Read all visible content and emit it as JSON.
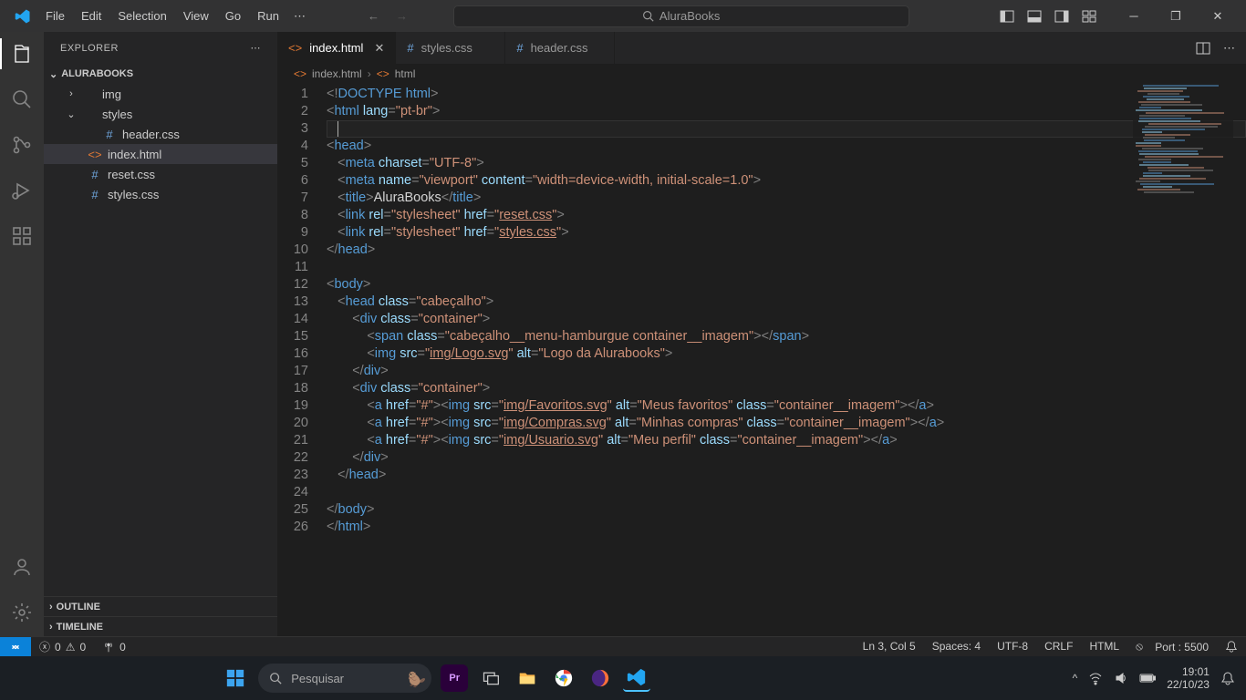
{
  "titlebar": {
    "menu": [
      "File",
      "Edit",
      "Selection",
      "View",
      "Go",
      "Run"
    ],
    "search_text": "AluraBooks"
  },
  "sidebar": {
    "header": "EXPLORER",
    "project": "ALURABOOKS",
    "tree": [
      {
        "label": "img",
        "chev": "›",
        "indent": 18,
        "icon": ""
      },
      {
        "label": "styles",
        "chev": "⌄",
        "indent": 18,
        "icon": ""
      },
      {
        "label": "header.css",
        "chev": "",
        "indent": 40,
        "icon": "#",
        "iclass": "css-ic"
      },
      {
        "label": "index.html",
        "chev": "",
        "indent": 24,
        "icon": "<>",
        "iclass": "html-ic",
        "selected": true
      },
      {
        "label": "reset.css",
        "chev": "",
        "indent": 24,
        "icon": "#",
        "iclass": "css-ic"
      },
      {
        "label": "styles.css",
        "chev": "",
        "indent": 24,
        "icon": "#",
        "iclass": "css-ic"
      }
    ],
    "outline": "OUTLINE",
    "timeline": "TIMELINE"
  },
  "tabs": [
    {
      "label": "index.html",
      "icon": "<>",
      "iclass": "html-ic",
      "active": true
    },
    {
      "label": "styles.css",
      "icon": "#",
      "iclass": "css-ic"
    },
    {
      "label": "header.css",
      "icon": "#",
      "iclass": "css-ic"
    }
  ],
  "breadcrumb": {
    "file": "index.html",
    "node": "html"
  },
  "status": {
    "errors": "0",
    "warnings": "0",
    "ports": "0",
    "lncol": "Ln 3, Col 5",
    "spaces": "Spaces: 4",
    "enc": "UTF-8",
    "eol": "CRLF",
    "lang": "HTML",
    "port": "Port : 5500"
  },
  "code": {
    "lines": 26,
    "l1": {
      "open": "<!",
      "doctype": "DOCTYPE",
      "html": "html",
      "close": ">"
    },
    "l2": {
      "tag": "html",
      "attr": "lang",
      "val": "\"pt-br\""
    },
    "l4": {
      "tag": "head"
    },
    "l5": {
      "tag": "meta",
      "attr": "charset",
      "val": "\"UTF-8\""
    },
    "l6": {
      "tag": "meta",
      "attr1": "name",
      "val1": "\"viewport\"",
      "attr2": "content",
      "val2": "\"width=device-width, initial-scale=1.0\""
    },
    "l7": {
      "tag": "title",
      "text": "AluraBooks"
    },
    "l8": {
      "tag": "link",
      "attr1": "rel",
      "val1": "\"stylesheet\"",
      "attr2": "href",
      "val2": "reset.css"
    },
    "l9": {
      "tag": "link",
      "attr1": "rel",
      "val1": "\"stylesheet\"",
      "attr2": "href",
      "val2": "styles.css"
    },
    "l10": {
      "tag": "head"
    },
    "l12": {
      "tag": "body"
    },
    "l13": {
      "tag": "head",
      "attr": "class",
      "val": "\"cabeçalho\""
    },
    "l14": {
      "tag": "div",
      "attr": "class",
      "val": "\"container\""
    },
    "l15": {
      "tag": "span",
      "attr": "class",
      "val": "\"cabeçalho__menu-hamburgue container__imagem\""
    },
    "l16": {
      "tag": "img",
      "attr1": "src",
      "val1": "img/Logo.svg",
      "attr2": "alt",
      "val2": "\"Logo da Alurabooks\""
    },
    "l17": {
      "tag": "div"
    },
    "l18": {
      "tag": "div",
      "attr": "class",
      "val": "\"container\""
    },
    "l19": {
      "src": "img/Favoritos.svg",
      "alt": "\"Meus favoritos\"",
      "cls": "\"container__imagem\""
    },
    "l20": {
      "src": "img/Compras.svg",
      "alt": "\"Minhas compras\"",
      "cls": "\"container__imagem\""
    },
    "l21": {
      "src": "img/Usuario.svg",
      "alt": "\"Meu perfil\"",
      "cls": "\"container__imagem\""
    },
    "l22": {
      "tag": "div"
    },
    "l23": {
      "tag": "head"
    },
    "l25": {
      "tag": "body"
    },
    "l26": {
      "tag": "html"
    }
  },
  "taskbar": {
    "search": "Pesquisar",
    "time": "19:01",
    "date": "22/10/23"
  }
}
